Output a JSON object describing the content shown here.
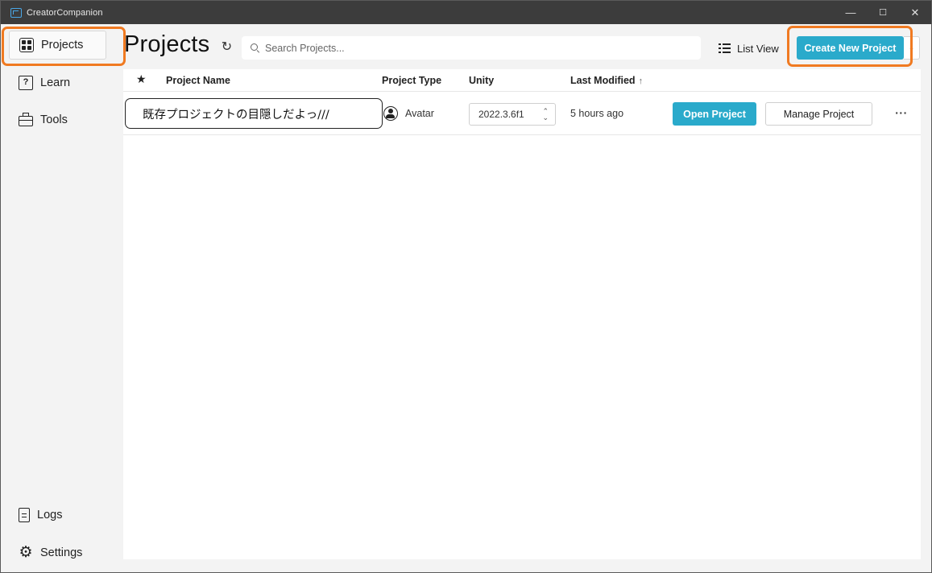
{
  "window": {
    "title": "CreatorCompanion",
    "minimize": "—",
    "maximize": "☐",
    "close": "✕"
  },
  "sidebar": {
    "items": [
      {
        "label": "Projects",
        "icon": "projects-grid-icon",
        "active": true
      },
      {
        "label": "Learn",
        "icon": "help-square-icon"
      },
      {
        "label": "Tools",
        "icon": "toolbox-icon"
      }
    ],
    "bottom_items": [
      {
        "label": "Logs",
        "icon": "document-icon"
      },
      {
        "label": "Settings",
        "icon": "gear-icon"
      }
    ]
  },
  "header": {
    "title": "Projects",
    "refresh_icon": "↻",
    "search_placeholder": "Search Projects...",
    "view_toggle_label": "List View",
    "create_button_label": "Create New Project",
    "create_dropdown_icon": "⌄"
  },
  "table": {
    "columns": {
      "favorite": "★",
      "name": "Project Name",
      "type": "Project Type",
      "unity": "Unity",
      "modified": "Last Modified",
      "sort_indicator": "↑"
    },
    "rows": [
      {
        "name": "既存プロジェクトの目隠しだよっ///",
        "type": "Avatar",
        "unity_version": "2022.3.6f1",
        "last_modified": "5 hours ago",
        "open_label": "Open Project",
        "manage_label": "Manage Project",
        "more_label": "···"
      }
    ]
  },
  "colors": {
    "accent": "#2aaacb",
    "highlight": "#f07a21",
    "titlebar": "#3c3c3c"
  }
}
